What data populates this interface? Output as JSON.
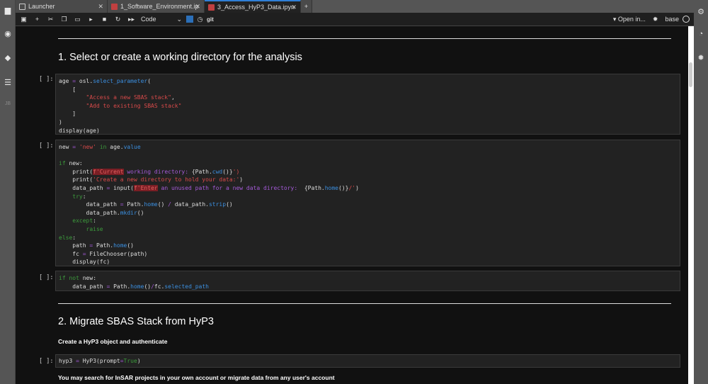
{
  "tabs": [
    {
      "label": "Launcher",
      "icon": "launcher-icon"
    },
    {
      "label": "1_Software_Environment.ip",
      "icon": "notebook-icon"
    },
    {
      "label": "3_Access_HyP3_Data.ipyn",
      "icon": "notebook-icon",
      "active": true
    }
  ],
  "toolbar": {
    "cell_type": "Code",
    "git": "git",
    "open_in": "Open in...",
    "kernel": "base"
  },
  "sidebar": {
    "jb": "JB"
  },
  "headings": {
    "h1": "1. Select or create a working directory for the analysis",
    "h2": "2. Migrate SBAS Stack from HyP3"
  },
  "paragraphs": {
    "p1": "Create a HyP3 object and authenticate",
    "p2": "You may search for InSAR projects in your own account or migrate data from any user's account"
  },
  "prompt": "[ ]:",
  "cells": [
    [
      [
        [
          "age ",
          ""
        ],
        [
          "=",
          "op"
        ],
        [
          " osl.",
          ""
        ],
        [
          "select_parameter",
          "fn"
        ],
        [
          "(",
          ""
        ]
      ],
      [
        [
          "    [",
          ""
        ]
      ],
      [
        [
          "        ",
          ""
        ],
        [
          "\"Access a new SBAS stack\"",
          "st"
        ],
        [
          ",",
          ""
        ]
      ],
      [
        [
          "        ",
          ""
        ],
        [
          "\"Add to existing SBAS stack\"",
          "st"
        ]
      ],
      [
        [
          "    ]",
          ""
        ]
      ],
      [
        [
          ")",
          ""
        ]
      ],
      [
        [
          "display(age)",
          ""
        ]
      ]
    ],
    [
      [
        [
          "new ",
          ""
        ],
        [
          "=",
          "op"
        ],
        [
          " ",
          ""
        ],
        [
          "'new'",
          "st"
        ],
        [
          " ",
          ""
        ],
        [
          "in",
          "kw"
        ],
        [
          " age.",
          ""
        ],
        [
          "value",
          "fn"
        ]
      ],
      [
        [
          "",
          ""
        ]
      ],
      [
        [
          "if",
          "kw"
        ],
        [
          " new:",
          ""
        ]
      ],
      [
        [
          "    print(",
          ""
        ],
        [
          "f'Current",
          "hl"
        ],
        [
          " working directory: ",
          "fs"
        ],
        [
          "{Path.",
          ""
        ],
        [
          "cwd",
          "fn"
        ],
        [
          "()}",
          ""
        ],
        [
          "')",
          "st"
        ]
      ],
      [
        [
          "    print(",
          ""
        ],
        [
          "'Create a new directory to hold your data:'",
          "st"
        ],
        [
          ")",
          ""
        ]
      ],
      [
        [
          "    data_path ",
          ""
        ],
        [
          "=",
          "op"
        ],
        [
          " input(",
          ""
        ],
        [
          "f'Enter",
          "hl"
        ],
        [
          " an unused path for a new data directory:  ",
          "fs"
        ],
        [
          "{Path.",
          ""
        ],
        [
          "home",
          "fn"
        ],
        [
          "()}",
          ""
        ],
        [
          "/'",
          "st"
        ],
        [
          ")",
          ""
        ]
      ],
      [
        [
          "    ",
          ""
        ],
        [
          "try",
          "kw"
        ],
        [
          ":",
          ""
        ]
      ],
      [
        [
          "        data_path ",
          ""
        ],
        [
          "=",
          "op"
        ],
        [
          " Path.",
          ""
        ],
        [
          "home",
          "fn"
        ],
        [
          "() ",
          ""
        ],
        [
          "/",
          "op"
        ],
        [
          " data_path.",
          ""
        ],
        [
          "strip",
          "fn"
        ],
        [
          "()",
          ""
        ]
      ],
      [
        [
          "        data_path.",
          ""
        ],
        [
          "mkdir",
          "fn"
        ],
        [
          "()",
          ""
        ]
      ],
      [
        [
          "    ",
          ""
        ],
        [
          "except",
          "kw"
        ],
        [
          ":",
          ""
        ]
      ],
      [
        [
          "        ",
          ""
        ],
        [
          "raise",
          "kw"
        ]
      ],
      [
        [
          "else",
          "kw"
        ],
        [
          ":",
          ""
        ]
      ],
      [
        [
          "    path ",
          ""
        ],
        [
          "=",
          "op"
        ],
        [
          " Path.",
          ""
        ],
        [
          "home",
          "fn"
        ],
        [
          "()",
          ""
        ]
      ],
      [
        [
          "    fc ",
          ""
        ],
        [
          "=",
          "op"
        ],
        [
          " FileChooser(path)",
          ""
        ]
      ],
      [
        [
          "    display(fc)",
          ""
        ]
      ]
    ],
    [
      [
        [
          "if",
          "kw"
        ],
        [
          " ",
          ""
        ],
        [
          "not",
          "kw"
        ],
        [
          " new:",
          ""
        ]
      ],
      [
        [
          "    data_path ",
          ""
        ],
        [
          "=",
          "op"
        ],
        [
          " Path.",
          ""
        ],
        [
          "home",
          "fn"
        ],
        [
          "()",
          ""
        ],
        [
          "/",
          "op"
        ],
        [
          "fc.",
          ""
        ],
        [
          "selected_path",
          "fn"
        ]
      ]
    ],
    [
      [
        [
          "hyp3 ",
          ""
        ],
        [
          "=",
          "op"
        ],
        [
          " HyP3(prompt",
          ""
        ],
        [
          "=",
          "op"
        ],
        [
          "True",
          "kw"
        ],
        [
          ")",
          ""
        ]
      ]
    ]
  ]
}
